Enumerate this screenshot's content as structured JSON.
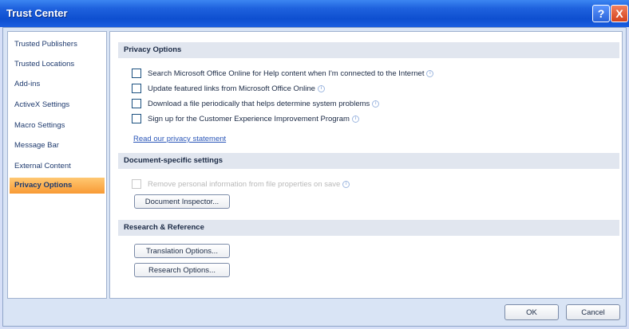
{
  "window": {
    "title": "Trust Center",
    "help_glyph": "?",
    "close_glyph": "X"
  },
  "sidebar": {
    "items": [
      {
        "label": "Trusted Publishers"
      },
      {
        "label": "Trusted Locations"
      },
      {
        "label": "Add-ins"
      },
      {
        "label": "ActiveX Settings"
      },
      {
        "label": "Macro Settings"
      },
      {
        "label": "Message Bar"
      },
      {
        "label": "External Content"
      },
      {
        "label": "Privacy Options",
        "selected": true
      }
    ]
  },
  "privacy": {
    "header": "Privacy Options",
    "options": [
      {
        "label": "Search Microsoft Office Online for Help content when I'm connected to the Internet",
        "checked": false
      },
      {
        "label": "Update featured links from Microsoft Office Online",
        "checked": false
      },
      {
        "label": "Download a file periodically that helps determine system problems",
        "checked": false
      },
      {
        "label": "Sign up for the Customer Experience Improvement Program",
        "checked": false
      }
    ],
    "link": "Read our privacy statement"
  },
  "document": {
    "header": "Document-specific settings",
    "option": {
      "label": "Remove personal information from file properties on save",
      "checked": false,
      "enabled": false
    },
    "button": "Document Inspector..."
  },
  "research": {
    "header": "Research & Reference",
    "buttons": [
      "Translation Options...",
      "Research Options..."
    ]
  },
  "footer": {
    "ok": "OK",
    "cancel": "Cancel"
  }
}
